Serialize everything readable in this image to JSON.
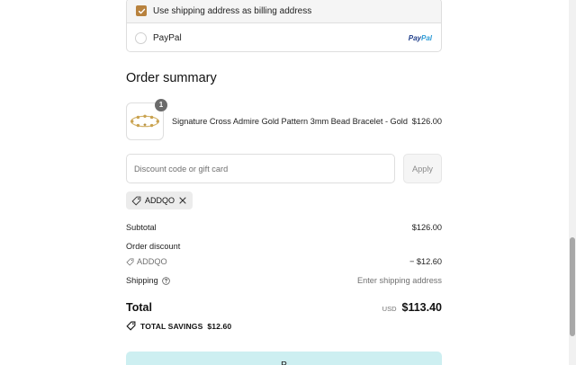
{
  "payment": {
    "billing_checkbox_label": "Use shipping address as billing address",
    "billing_checked": true,
    "paypal_label": "PayPal",
    "paypal_logo_a": "Pay",
    "paypal_logo_b": "Pal"
  },
  "summary": {
    "title": "Order summary",
    "item": {
      "quantity": "1",
      "name": "Signature Cross Admire Gold Pattern 3mm Bead Bracelet - Gold",
      "price": "$126.00"
    }
  },
  "discount": {
    "placeholder": "Discount code or gift card",
    "apply_label": "Apply",
    "applied_code": "ADDQO"
  },
  "totals": {
    "subtotal_label": "Subtotal",
    "subtotal_value": "$126.00",
    "order_discount_label": "Order discount",
    "discount_code": "ADDQO",
    "discount_value": "− $12.60",
    "shipping_label": "Shipping",
    "shipping_value": "Enter shipping address",
    "total_label": "Total",
    "currency": "USD",
    "total_value": "$113.40",
    "savings_label": "TOTAL SAVINGS",
    "savings_value": "$12.60"
  },
  "pay_button": {
    "label": "P"
  },
  "colors": {
    "accent": "#b8823e",
    "pay_button": "#cdeff1",
    "paypal_dark": "#1f3e8a",
    "paypal_light": "#2c9bd6"
  },
  "icons": [
    "check-icon",
    "radio-icon",
    "tag-icon",
    "close-icon",
    "help-icon",
    "savings-tag-icon"
  ]
}
